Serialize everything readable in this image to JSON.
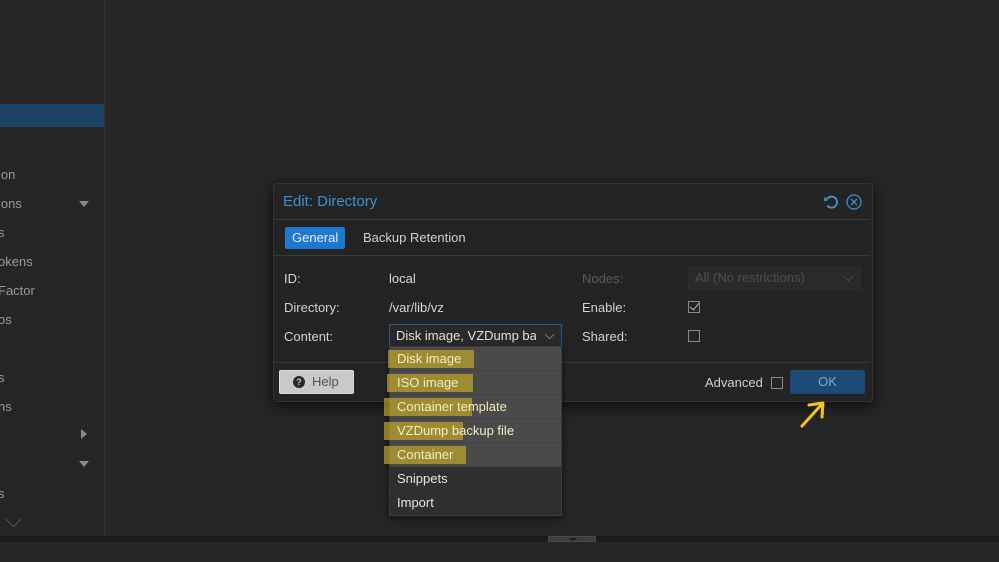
{
  "sidebar": {
    "items": [
      {
        "label": "ion",
        "expander": "none"
      },
      {
        "label": "ions",
        "expander": "collapse"
      },
      {
        "label": "s",
        "expander": "none"
      },
      {
        "label": "okens",
        "expander": "none"
      },
      {
        "label": "Factor",
        "expander": "none"
      },
      {
        "label": "os",
        "expander": "none"
      },
      {
        "label": "",
        "expander": "none"
      },
      {
        "label": "s",
        "expander": "none"
      },
      {
        "label": "ns",
        "expander": "none"
      },
      {
        "label": "",
        "expander": "expand"
      },
      {
        "label": "",
        "expander": "collapse"
      },
      {
        "label": "s",
        "expander": "none"
      }
    ]
  },
  "dialog": {
    "title": "Edit: Directory",
    "tabs": [
      {
        "label": "General",
        "active": true
      },
      {
        "label": "Backup Retention",
        "active": false
      }
    ],
    "fields": {
      "id_label": "ID:",
      "id_value": "local",
      "directory_label": "Directory:",
      "directory_value": "/var/lib/vz",
      "content_label": "Content:",
      "content_value": "Disk image, VZDump backup file",
      "nodes_label": "Nodes:",
      "nodes_value": "All (No restrictions)",
      "enable_label": "Enable:",
      "enable_checked": true,
      "shared_label": "Shared:",
      "shared_checked": false
    },
    "footer": {
      "help_label": "Help",
      "advanced_label": "Advanced",
      "advanced_checked": false,
      "ok_label": "OK"
    }
  },
  "content_dropdown": {
    "options": [
      {
        "label": "Disk image",
        "selected": true,
        "highlighted": true
      },
      {
        "label": "ISO image",
        "selected": true,
        "highlighted": true
      },
      {
        "label": "Container template",
        "selected": true,
        "highlighted": true
      },
      {
        "label": "VZDump backup file",
        "selected": true,
        "highlighted": true
      },
      {
        "label": "Container",
        "selected": true,
        "highlighted": true
      },
      {
        "label": "Snippets",
        "selected": false,
        "highlighted": false
      },
      {
        "label": "Import",
        "selected": false,
        "highlighted": false
      }
    ]
  },
  "colors": {
    "accent": "#1e78cf",
    "title_blue": "#3d8fd1",
    "highlight_yellow": "#d2b428",
    "annotation_arrow": "#f5c518"
  }
}
